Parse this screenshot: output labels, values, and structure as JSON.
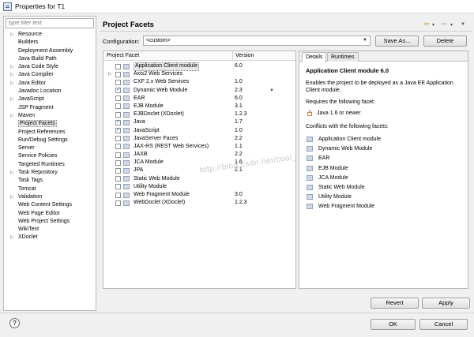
{
  "window": {
    "title": "Properties for T1"
  },
  "filter": {
    "placeholder": "type filter text"
  },
  "nav": {
    "items": [
      {
        "label": "Resource",
        "expandable": true,
        "selected": false
      },
      {
        "label": "Builders",
        "expandable": false,
        "selected": false
      },
      {
        "label": "Deployment Assembly",
        "expandable": false,
        "selected": false
      },
      {
        "label": "Java Build Path",
        "expandable": false,
        "selected": false
      },
      {
        "label": "Java Code Style",
        "expandable": true,
        "selected": false
      },
      {
        "label": "Java Compiler",
        "expandable": true,
        "selected": false
      },
      {
        "label": "Java Editor",
        "expandable": true,
        "selected": false
      },
      {
        "label": "Javadoc Location",
        "expandable": false,
        "selected": false
      },
      {
        "label": "JavaScript",
        "expandable": true,
        "selected": false
      },
      {
        "label": "JSP Fragment",
        "expandable": false,
        "selected": false
      },
      {
        "label": "Maven",
        "expandable": true,
        "selected": false
      },
      {
        "label": "Project Facets",
        "expandable": false,
        "selected": true
      },
      {
        "label": "Project References",
        "expandable": false,
        "selected": false
      },
      {
        "label": "Run/Debug Settings",
        "expandable": false,
        "selected": false
      },
      {
        "label": "Server",
        "expandable": false,
        "selected": false
      },
      {
        "label": "Service Policies",
        "expandable": false,
        "selected": false
      },
      {
        "label": "Targeted Runtimes",
        "expandable": false,
        "selected": false
      },
      {
        "label": "Task Repository",
        "expandable": true,
        "selected": false
      },
      {
        "label": "Task Tags",
        "expandable": false,
        "selected": false
      },
      {
        "label": "Tomcat",
        "expandable": false,
        "selected": false
      },
      {
        "label": "Validation",
        "expandable": true,
        "selected": false
      },
      {
        "label": "Web Content Settings",
        "expandable": false,
        "selected": false
      },
      {
        "label": "Web Page Editor",
        "expandable": false,
        "selected": false
      },
      {
        "label": "Web Project Settings",
        "expandable": false,
        "selected": false
      },
      {
        "label": "WikiText",
        "expandable": false,
        "selected": false
      },
      {
        "label": "XDoclet",
        "expandable": true,
        "selected": false
      }
    ]
  },
  "header": {
    "title": "Project Facets"
  },
  "configuration": {
    "label": "Configuration:",
    "value": "<custom>"
  },
  "buttons": {
    "save_as": "Save As...",
    "delete": "Delete",
    "revert": "Revert",
    "apply": "Apply",
    "ok": "OK",
    "cancel": "Cancel",
    "help": "?"
  },
  "facets": {
    "col_facet": "Project Facet",
    "col_version": "Version",
    "rows": [
      {
        "name": "Application Client module",
        "version": "6.0",
        "checked": false,
        "expandable": false,
        "selected": true,
        "dropdown": false
      },
      {
        "name": "Axis2 Web Services",
        "version": "",
        "checked": false,
        "expandable": true,
        "selected": false,
        "dropdown": false
      },
      {
        "name": "CXF 2.x Web Services",
        "version": "1.0",
        "checked": false,
        "expandable": false,
        "selected": false,
        "dropdown": false
      },
      {
        "name": "Dynamic Web Module",
        "version": "2.3",
        "checked": true,
        "expandable": false,
        "selected": false,
        "dropdown": true
      },
      {
        "name": "EAR",
        "version": "6.0",
        "checked": false,
        "expandable": false,
        "selected": false,
        "dropdown": false
      },
      {
        "name": "EJB Module",
        "version": "3.1",
        "checked": false,
        "expandable": false,
        "selected": false,
        "dropdown": false
      },
      {
        "name": "EJBDoclet (XDoclet)",
        "version": "1.2.3",
        "checked": false,
        "expandable": false,
        "selected": false,
        "dropdown": false
      },
      {
        "name": "Java",
        "version": "1.7",
        "checked": true,
        "expandable": false,
        "selected": false,
        "dropdown": false
      },
      {
        "name": "JavaScript",
        "version": "1.0",
        "checked": true,
        "expandable": false,
        "selected": false,
        "dropdown": false
      },
      {
        "name": "JavaServer Faces",
        "version": "2.2",
        "checked": false,
        "expandable": false,
        "selected": false,
        "dropdown": false
      },
      {
        "name": "JAX-RS (REST Web Services)",
        "version": "1.1",
        "checked": false,
        "expandable": false,
        "selected": false,
        "dropdown": false
      },
      {
        "name": "JAXB",
        "version": "2.2",
        "checked": false,
        "expandable": false,
        "selected": false,
        "dropdown": false
      },
      {
        "name": "JCA Module",
        "version": "1.6",
        "checked": false,
        "expandable": false,
        "selected": false,
        "dropdown": false
      },
      {
        "name": "JPA",
        "version": "2.1",
        "checked": false,
        "expandable": false,
        "selected": false,
        "dropdown": false
      },
      {
        "name": "Static Web Module",
        "version": "",
        "checked": false,
        "expandable": false,
        "selected": false,
        "dropdown": false
      },
      {
        "name": "Utility Module",
        "version": "",
        "checked": false,
        "expandable": false,
        "selected": false,
        "dropdown": false
      },
      {
        "name": "Web Fragment Module",
        "version": "3.0",
        "checked": false,
        "expandable": false,
        "selected": false,
        "dropdown": false
      },
      {
        "name": "WebDoclet (XDoclet)",
        "version": "1.2.3",
        "checked": false,
        "expandable": false,
        "selected": false,
        "dropdown": false
      }
    ]
  },
  "details": {
    "tabs": [
      "Details",
      "Runtimes"
    ],
    "title": "Application Client module 6.0",
    "description": "Enables the project to be deployed as a Java EE Application Client module.",
    "requires_label": "Requires the following facet:",
    "requires_item": "Java 1.6 or newer",
    "conflicts_label": "Conflicts with the following facets:",
    "conflicts": [
      "Application Client module",
      "Dynamic Web Module",
      "EAR",
      "EJB Module",
      "JCA Module",
      "Static Web Module",
      "Utility Module",
      "Web Fragment Module"
    ]
  },
  "watermark": "http://blog.csdn.net/cool_"
}
